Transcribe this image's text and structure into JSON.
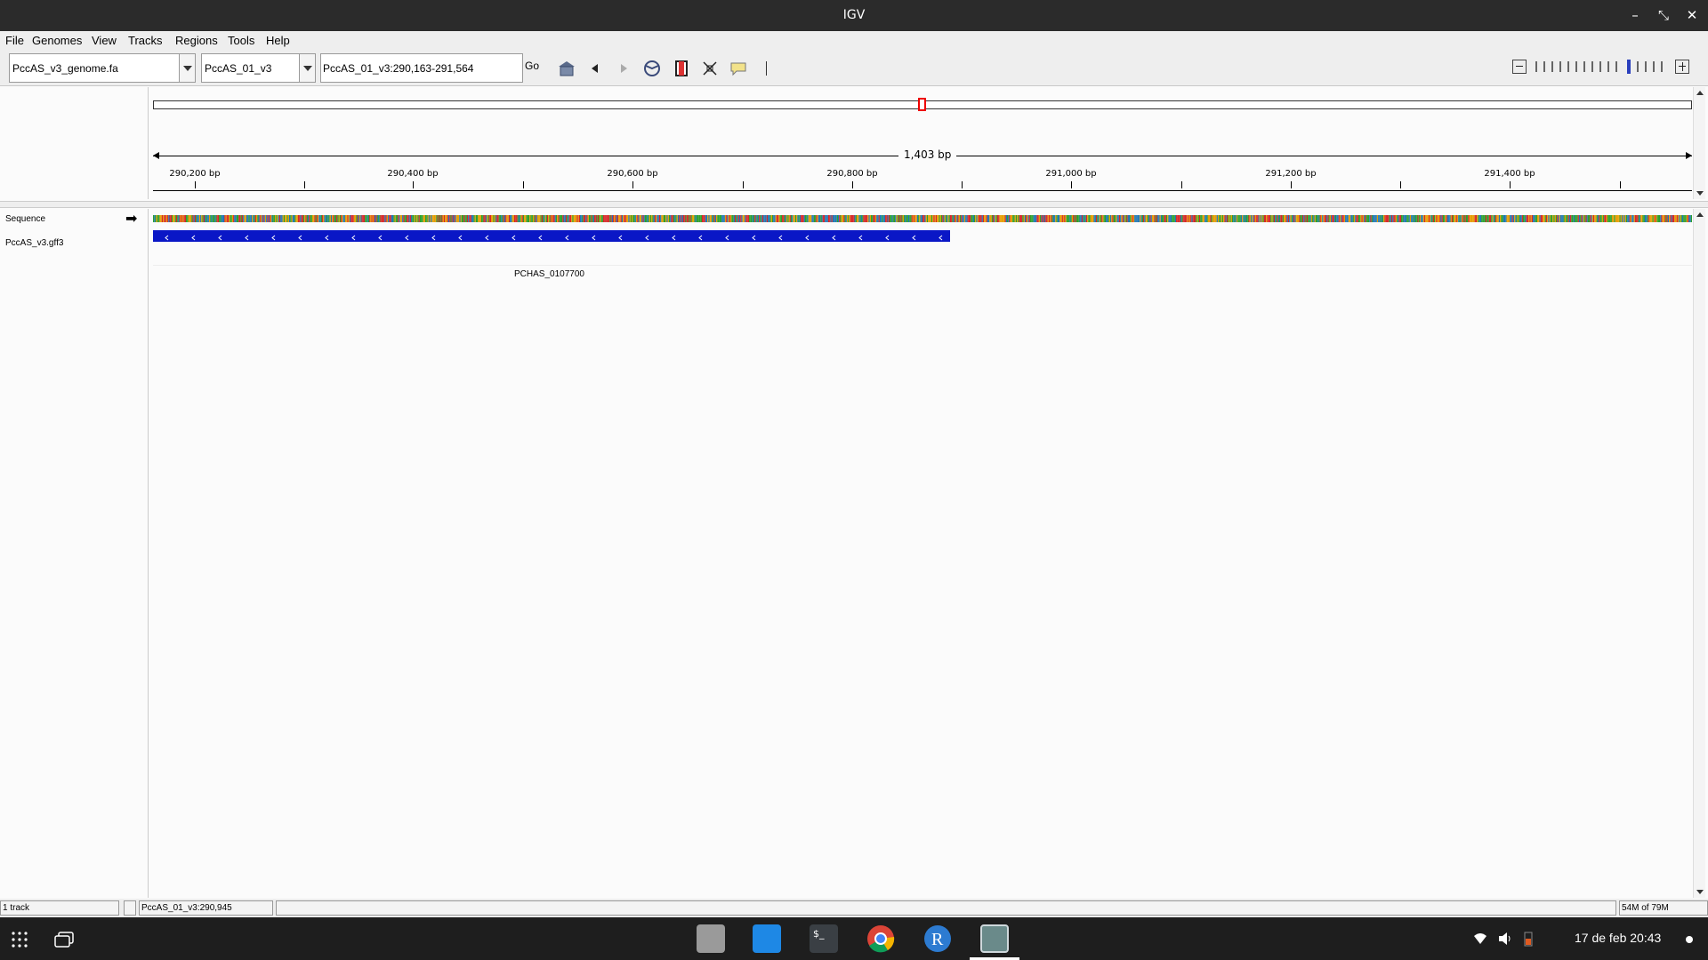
{
  "window": {
    "title": "IGV"
  },
  "menu": [
    "File",
    "Genomes",
    "View",
    "Tracks",
    "Regions",
    "Tools",
    "Help"
  ],
  "toolbar": {
    "genome": "PccAS_v3_genome.fa",
    "chromosome": "PccAS_01_v3",
    "locus": "PccAS_01_v3:290,163-291,564",
    "go_label": "Go"
  },
  "ruler": {
    "span_label": "1,403 bp",
    "ticks": [
      "290,200 bp",
      "290,400 bp",
      "290,600 bp",
      "290,800 bp",
      "291,000 bp",
      "291,200 bp",
      "291,400 bp"
    ]
  },
  "tracks": {
    "sequence_label": "Sequence",
    "annotation_label": "PccAS_v3.gff3",
    "gene_name": "PCHAS_0107700"
  },
  "status": {
    "track_count": "1 track",
    "position": "PccAS_01_v3:290,945",
    "memory": "54M of 79M"
  },
  "taskbar": {
    "clock": "17 de feb  20:43"
  },
  "colors": {
    "gene": "#0a17c6",
    "marker": "#e00000"
  }
}
